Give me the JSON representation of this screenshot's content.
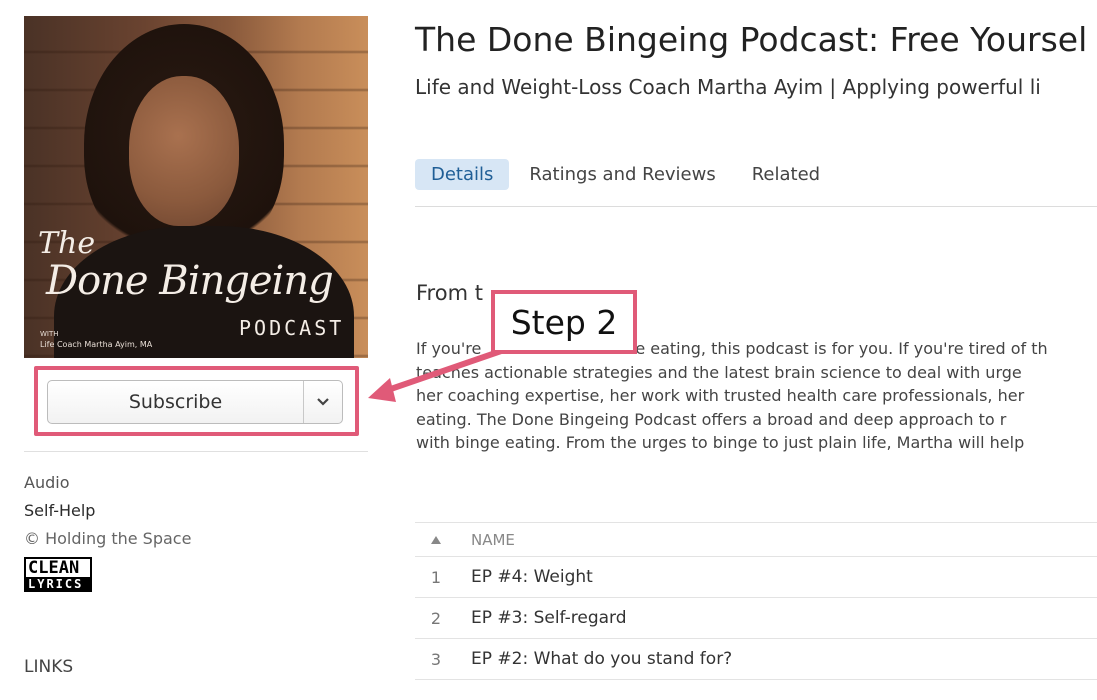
{
  "podcast": {
    "title": "The Done Bingeing Podcast: Free Yoursel",
    "subtitle": "Life and Weight-Loss Coach Martha Ayim | Applying powerful li",
    "artwork": {
      "script_line1": "The",
      "script_line2": "Done Bingeing",
      "with_label": "WITH",
      "coach_line": "Life Coach Martha Ayim, MA",
      "podcast_word": "PODCAST"
    }
  },
  "subscribe": {
    "label": "Subscribe",
    "caret_icon": "chevron-down-icon"
  },
  "sidebar": {
    "media_type": "Audio",
    "genre": "Self-Help",
    "copyright": "© Holding the Space",
    "badge_top": "CLEAN",
    "badge_bottom": "LYRICS",
    "links_heading": "LINKS"
  },
  "tabs": [
    {
      "label": "Details",
      "active": true
    },
    {
      "label": "Ratings and Reviews",
      "active": false
    },
    {
      "label": "Related",
      "active": false
    }
  ],
  "details": {
    "heading": "From t",
    "description_lines": [
      "If you're",
      "teaches actionable strategies and the latest brain science to deal with urge",
      "her coaching expertise, her work with trusted health care professionals, her",
      "eating. The Done Bingeing Podcast offers a broad and deep approach to r",
      "with binge eating. From the urges to binge to just plain life, Martha will help"
    ],
    "line1_tail": "e eating, this podcast is for you. If you're tired of th"
  },
  "episodes": {
    "sort_icon": "triangle-up-icon",
    "column_name": "NAME",
    "rows": [
      {
        "num": "1",
        "name": "EP #4: Weight"
      },
      {
        "num": "2",
        "name": "EP #3: Self-regard"
      },
      {
        "num": "3",
        "name": "EP #2: What do you stand for?"
      }
    ]
  },
  "annotation": {
    "step_label": "Step 2",
    "accent_color": "#e05a78"
  }
}
